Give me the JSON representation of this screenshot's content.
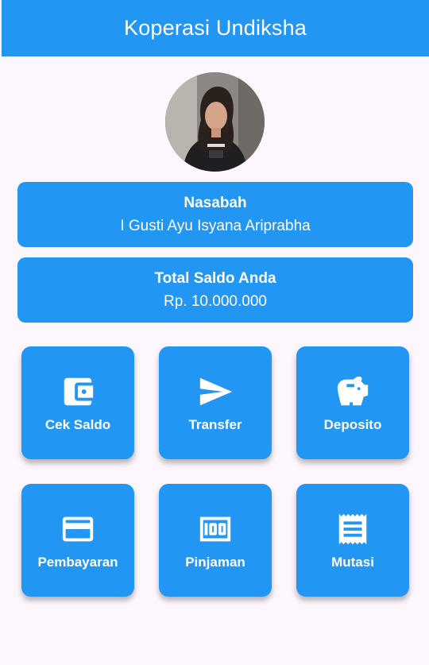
{
  "app_bar": {
    "title": "Koperasi Undiksha"
  },
  "profile": {
    "avatar_icon": "user-photo"
  },
  "nasabah_card": {
    "title": "Nasabah",
    "name": "I Gusti Ayu Isyana Ariprabha"
  },
  "saldo_card": {
    "title": "Total Saldo Anda",
    "amount": "Rp. 10.000.000"
  },
  "menu": [
    {
      "label": "Cek Saldo",
      "icon": "wallet-icon"
    },
    {
      "label": "Transfer",
      "icon": "send-icon"
    },
    {
      "label": "Deposito",
      "icon": "piggy-bank-icon"
    },
    {
      "label": "Pembayaran",
      "icon": "credit-card-icon"
    },
    {
      "label": "Pinjaman",
      "icon": "money-icon"
    },
    {
      "label": "Mutasi",
      "icon": "receipt-icon"
    }
  ],
  "colors": {
    "primary": "#2196f3",
    "background": "#fdf7fd",
    "text_on_primary": "#ffffff"
  }
}
